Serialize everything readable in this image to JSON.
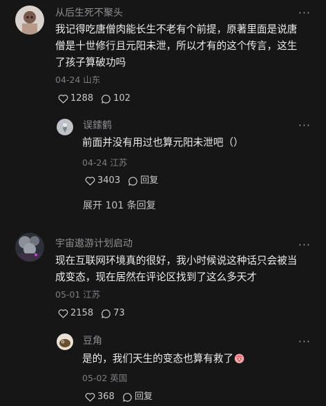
{
  "comments": [
    {
      "username": "从后生死不聚头",
      "text": "我记得吃唐僧肉能长生不老有个前提，原著里面是说唐\n僧是十世修行且元阳未泄，所以才有的这个传言，这生\n了孩子算破功吗",
      "meta": "04-24 山东",
      "likes": "1288",
      "replies": "102",
      "reply": {
        "username": "误鎍鹤",
        "text": "前面并没有用过也算元阳未泄吧（）",
        "meta": "04-24 江苏",
        "likes": "3403",
        "reply_label": "回复"
      },
      "expand_label": "展开 101 条回复"
    },
    {
      "username": "宇宙遨游计划启动",
      "text": "现在互联网环境真的很好，我小时候说这种话只会被当\n成变态，现在居然在评论区找到了这么多天才",
      "meta": "05-01 江苏",
      "likes": "2158",
      "replies": "73",
      "reply": {
        "username": "豆角",
        "text": "是的，我们天生的变态也算有救了",
        "meta": "05-02 英国",
        "likes": "368",
        "reply_label": "回复"
      }
    }
  ],
  "icons": {
    "like": "heart-icon",
    "comment": "comment-bubble-icon",
    "more": "more-dots-icon",
    "emoji": "emoji-icon"
  },
  "more_glyph": "···"
}
